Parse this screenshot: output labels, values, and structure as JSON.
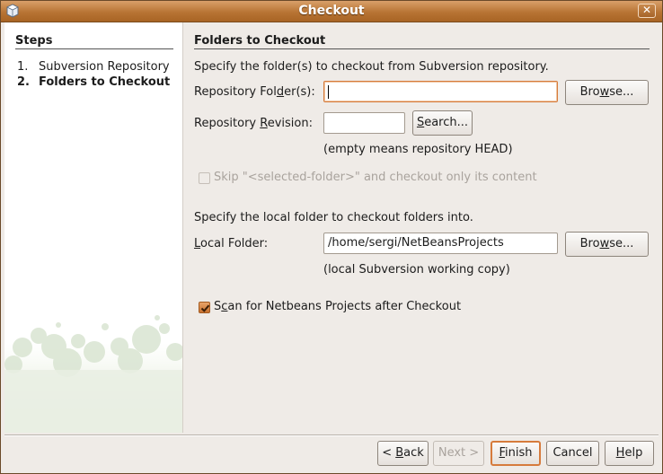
{
  "window": {
    "title": "Checkout",
    "close_glyph": "✕"
  },
  "steps": {
    "header": "Steps",
    "items": [
      {
        "num": "1.",
        "label": "Subversion Repository"
      },
      {
        "num": "2.",
        "label": "Folders to Checkout"
      }
    ]
  },
  "panel": {
    "title": "Folders to Checkout",
    "intro": "Specify the folder(s) to checkout from Subversion repository.",
    "repo_folder": {
      "label_pre": "Repository Fol",
      "label_mn": "d",
      "label_post": "er(s):",
      "value": "",
      "browse_pre": "Bro",
      "browse_mn": "w",
      "browse_post": "se..."
    },
    "repo_revision": {
      "label_pre": "Repository ",
      "label_mn": "R",
      "label_post": "evision:",
      "value": "",
      "search_pre": "",
      "search_mn": "S",
      "search_post": "earch...",
      "hint": "(empty means repository HEAD)"
    },
    "skip": {
      "label": "Skip \"<selected-folder>\" and checkout only its content",
      "checked": false,
      "enabled": false
    },
    "local_intro": "Specify the local folder to checkout folders into.",
    "local_folder": {
      "label_pre": "",
      "label_mn": "L",
      "label_post": "ocal Folder:",
      "value": "/home/sergi/NetBeansProjects",
      "browse_pre": "Bro",
      "browse_mn": "w",
      "browse_post": "se...",
      "hint": "(local Subversion working copy)"
    },
    "scan": {
      "label_pre": "S",
      "label_mn": "c",
      "label_post": "an for Netbeans Projects after Checkout",
      "checked": true
    }
  },
  "buttons": {
    "back": {
      "pre": "< ",
      "mn": "B",
      "post": "ack"
    },
    "next": {
      "label": "Next >"
    },
    "finish": {
      "pre": "",
      "mn": "F",
      "post": "inish"
    },
    "cancel": {
      "label": "Cancel"
    },
    "help": {
      "pre": "",
      "mn": "H",
      "post": "elp"
    }
  },
  "colors": {
    "titlebar": "#b87434",
    "accent": "#d67b3c",
    "background": "#efebe7"
  }
}
